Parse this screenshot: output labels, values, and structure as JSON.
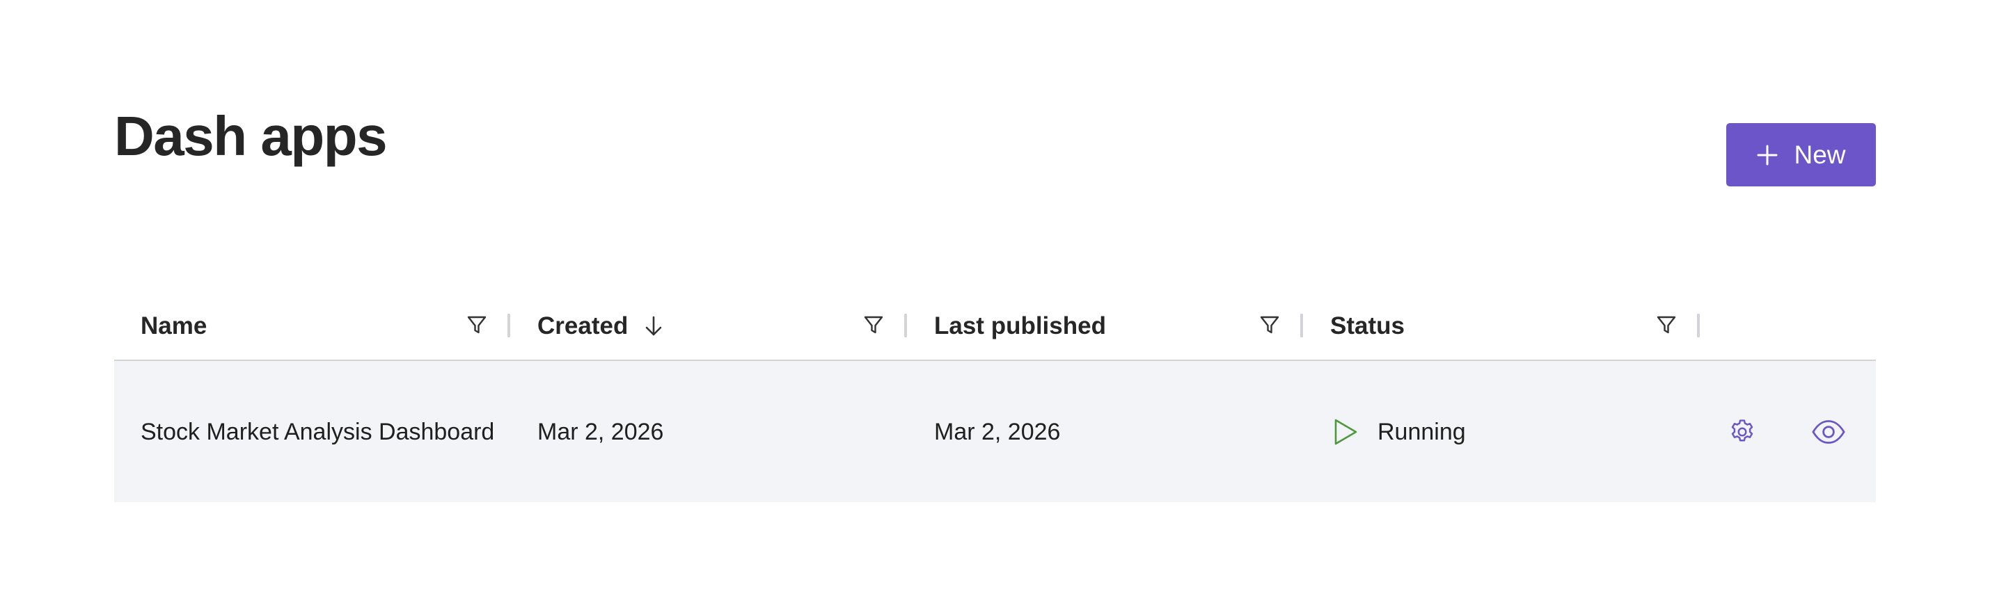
{
  "page": {
    "title": "Dash apps"
  },
  "toolbar": {
    "new_label": "New"
  },
  "table": {
    "columns": [
      {
        "key": "name",
        "label": "Name"
      },
      {
        "key": "created",
        "label": "Created",
        "sort": "descending"
      },
      {
        "key": "last_published",
        "label": "Last published"
      },
      {
        "key": "status",
        "label": "Status"
      }
    ],
    "rows": [
      {
        "name": "Stock Market Analysis Dashboard",
        "created": "Mar 2, 2026",
        "last_published": "Mar 2, 2026",
        "status": "Running"
      }
    ]
  },
  "icons": {
    "new": "plus-icon",
    "filter": "funnel-icon",
    "sort": "arrow-down-icon",
    "status": "play-icon",
    "settings": "gear-icon",
    "view": "eye-icon"
  },
  "colors": {
    "accent": "#6c55c9",
    "status_running": "#4c9a3c",
    "row_background": "#f3f4f8",
    "header_border": "#d4d4d8",
    "action_icon": "#6c55c9"
  }
}
